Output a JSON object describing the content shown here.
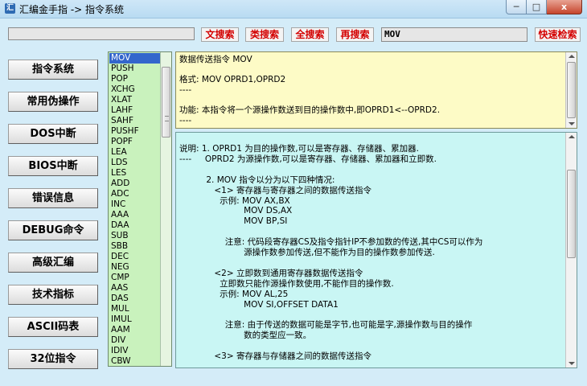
{
  "window": {
    "title": "汇编金手指 -> 指令系统",
    "min_label": "─",
    "max_label": "□",
    "close_label": "x"
  },
  "search": {
    "input_value": "",
    "buttons": [
      "文搜索",
      "类搜索",
      "全搜索",
      "再搜索"
    ],
    "keyword": "MOV",
    "quick_search_label": "快速检索"
  },
  "nav": {
    "items": [
      "指令系统",
      "常用伪操作",
      "DOS中断",
      "BIOS中断",
      "错误信息",
      "DEBUG命令",
      "高级汇编",
      "技术指标",
      "ASCII码表",
      "32位指令"
    ]
  },
  "instruction_list": {
    "selected": "MOV",
    "items": [
      "MOV",
      "PUSH",
      "POP",
      "XCHG",
      "XLAT",
      "LAHF",
      "SAHF",
      "PUSHF",
      "POPF",
      "LEA",
      "LDS",
      "LES",
      "ADD",
      "ADC",
      "INC",
      "AAA",
      "DAA",
      "SUB",
      "SBB",
      "DEC",
      "NEG",
      "CMP",
      "AAS",
      "DAS",
      "MUL",
      "IMUL",
      "AAM",
      "DIV",
      "IDIV",
      "CBW"
    ]
  },
  "summary": {
    "lines": [
      "数据传送指令 MOV",
      "",
      "格式: MOV OPRD1,OPRD2",
      "----",
      "",
      "功能: 本指令将一个源操作数送到目的操作数中,即OPRD1<--OPRD2.",
      "----"
    ]
  },
  "detail": {
    "lines": [
      "说明: 1. OPRD1 为目的操作数,可以是寄存器、存储器、累加器.",
      "----     OPRD2 为源操作数,可以是寄存器、存储器、累加器和立即数.",
      "",
      "          2. MOV 指令以分为以下四种情况:",
      "             <1> 寄存器与寄存器之间的数据传送指令",
      "               示例: MOV AX,BX",
      "                        MOV DS,AX",
      "                        MOV BP,SI",
      "",
      "                 注意: 代码段寄存器CS及指令指针IP不参加数的传送,其中CS可以作为",
      "                        源操作数参加传送,但不能作为目的操作数参加传送.",
      "",
      "             <2> 立即数到通用寄存器数据传送指令",
      "               立即数只能作源操作数使用,不能作目的操作数.",
      "               示例: MOV AL,25",
      "                        MOV SI,OFFSET DATA1",
      "",
      "                 注意: 由于传送的数据可能是字节,也可能是字,源操作数与目的操作",
      "                        数的类型应一致。",
      "",
      "             <3> 寄存器与存储器之间的数据传送指令"
    ]
  },
  "colors": {
    "search_button_text": "#d40000",
    "list_bg": "#c9f2bd",
    "summary_bg": "#fdfbc6",
    "detail_bg": "#c9f6f4",
    "selection": "#3366cc"
  }
}
